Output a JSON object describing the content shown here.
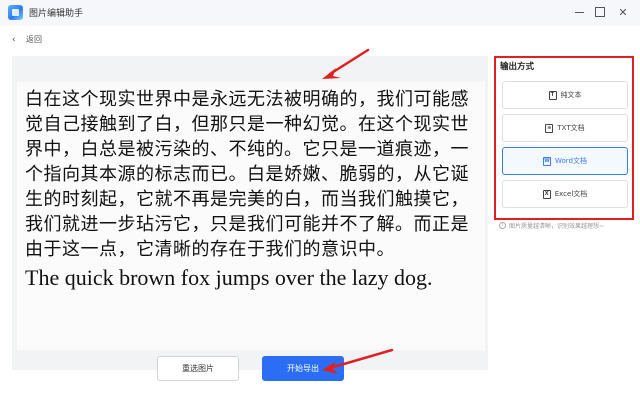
{
  "window": {
    "title": "图片编辑助手",
    "minimize": "minimize",
    "maximize": "maximize",
    "close": "✕"
  },
  "nav": {
    "back_label": "返回",
    "back_icon": "‹"
  },
  "preview": {
    "chinese_text": "白在这个现实世界中是永远无法被明确的，我们可能感觉自己接触到了白，但那只是一种幻觉。在这个现实世界中，白总是被污染的、不纯的。它只是一道痕迹，一个指向其本源的标志而已。白是娇嫩、脆弱的，从它诞生的时刻起，它就不再是完美的白，而当我们触摸它，我们就进一步玷污它，只是我们可能并不了解。而正是由于这一点，它清晰的存在于我们的意识中。",
    "english_text": "The quick brown fox jumps over the lazy dog."
  },
  "output": {
    "title": "输出方式",
    "options": [
      {
        "label": "纯文本",
        "icon": "text-doc-icon",
        "glyph": "T",
        "selected": false
      },
      {
        "label": "TXT文档",
        "icon": "txt-file-icon",
        "glyph": "≡",
        "selected": false
      },
      {
        "label": "Word文档",
        "icon": "word-file-icon",
        "glyph": "W",
        "selected": true
      },
      {
        "label": "Excel文档",
        "icon": "excel-file-icon",
        "glyph": "X",
        "selected": false
      }
    ],
    "hint": "图片质量越清晰，识别效果越理想~",
    "hint_icon": "i"
  },
  "actions": {
    "reselect_label": "重选图片",
    "export_label": "开始导出"
  },
  "colors": {
    "accent": "#2b6ef5",
    "highlight_border": "#e02020",
    "annotation_arrow": "#e02020"
  }
}
